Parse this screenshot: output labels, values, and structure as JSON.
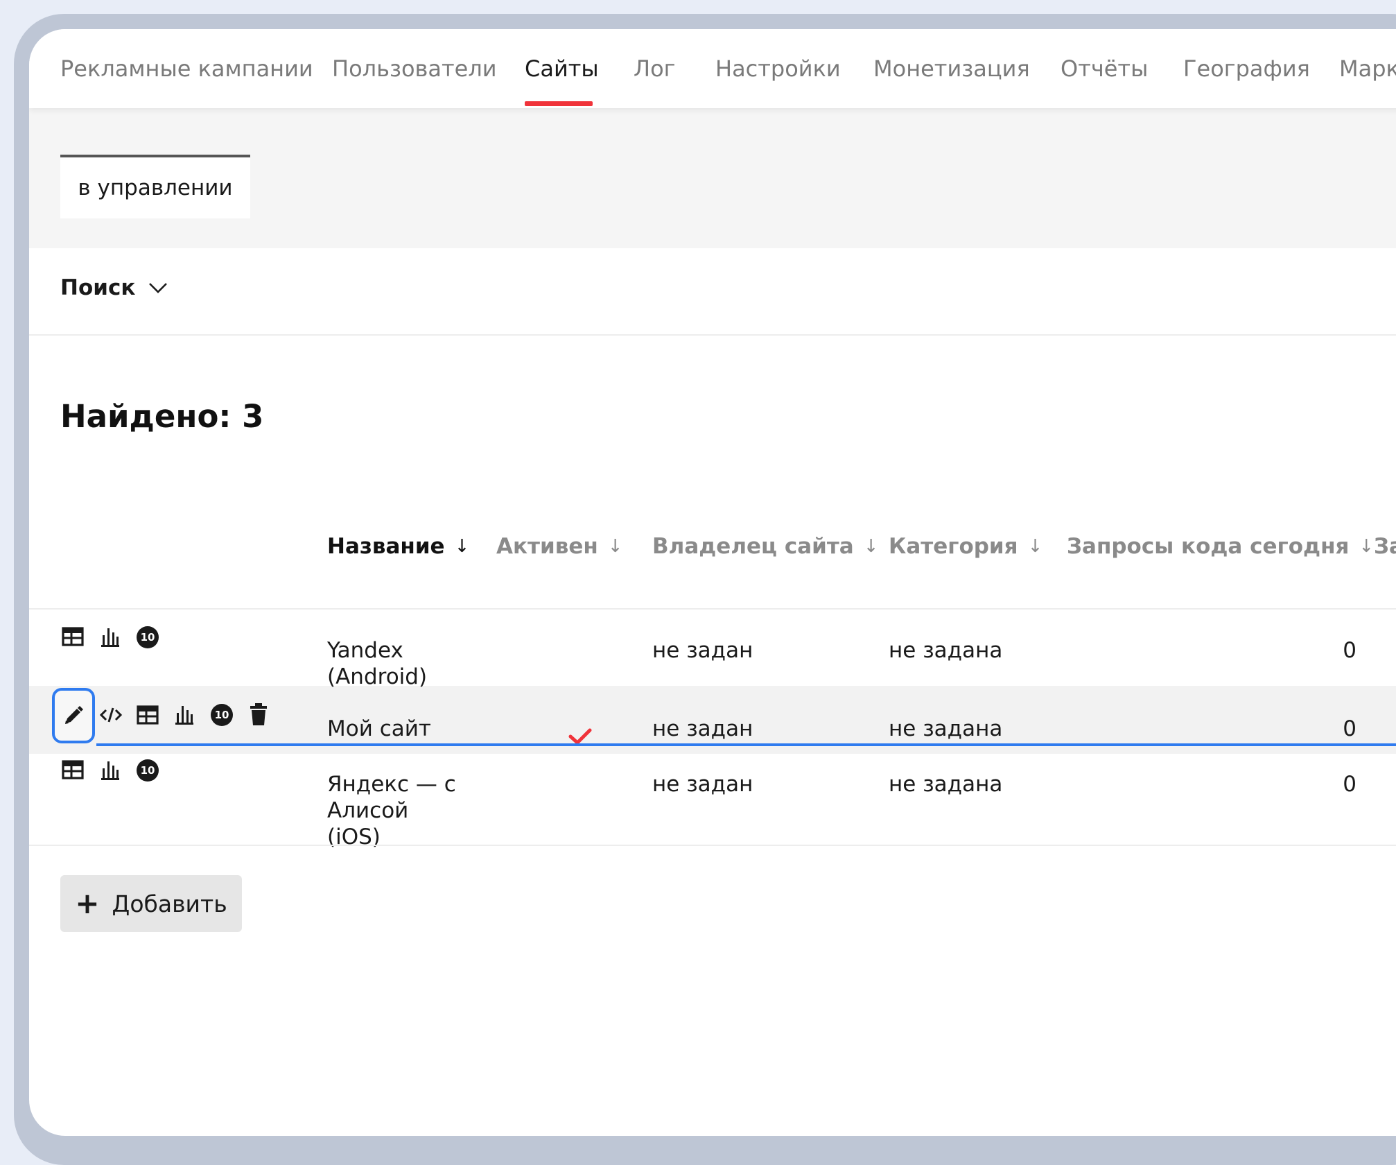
{
  "nav": {
    "tabs": [
      {
        "label": "Рекламные кампании"
      },
      {
        "label": "Пользователи"
      },
      {
        "label": "Сайты"
      },
      {
        "label": "Лог"
      },
      {
        "label": "Настройки"
      },
      {
        "label": "Монетизация"
      },
      {
        "label": "Отчёты"
      },
      {
        "label": "География"
      },
      {
        "label": "Марк"
      }
    ],
    "active_tab": "Сайты",
    "active_color": "#f0333a"
  },
  "subtab": {
    "label": "в управлении"
  },
  "search": {
    "label": "Поиск"
  },
  "found": {
    "label": "Найдено: 3"
  },
  "table": {
    "columns": [
      {
        "label": "Название",
        "sorted": true
      },
      {
        "label": "Активен"
      },
      {
        "label": "Владелец сайта"
      },
      {
        "label": "Категория"
      },
      {
        "label": "Запросы кода сегодня"
      },
      {
        "label": "За"
      }
    ],
    "rows": [
      {
        "name_lines": [
          "Yandex",
          "(Android)"
        ],
        "active": false,
        "owner": "не задан",
        "category": "не задана",
        "requests_today": "0",
        "actions": [
          "table-icon",
          "chart-icon",
          "badge-10-icon"
        ]
      },
      {
        "name_lines": [
          "Мой сайт"
        ],
        "active": true,
        "owner": "не задан",
        "category": "не задана",
        "requests_today": "0",
        "actions": [
          "pencil-icon",
          "code-icon",
          "table-icon",
          "chart-icon",
          "badge-10-icon",
          "trash-icon"
        ]
      },
      {
        "name_lines": [
          "Яндекс — с",
          "Алисой",
          "(iOS)"
        ],
        "active": false,
        "owner": "не задан",
        "category": "не задана",
        "requests_today": "0",
        "actions": [
          "table-icon",
          "chart-icon",
          "badge-10-icon"
        ]
      }
    ],
    "badge_text": "10",
    "focus_color": "#2f7bef",
    "check_color": "#f0333a"
  },
  "add_button": {
    "label": "Добавить",
    "icon": "plus-icon"
  }
}
